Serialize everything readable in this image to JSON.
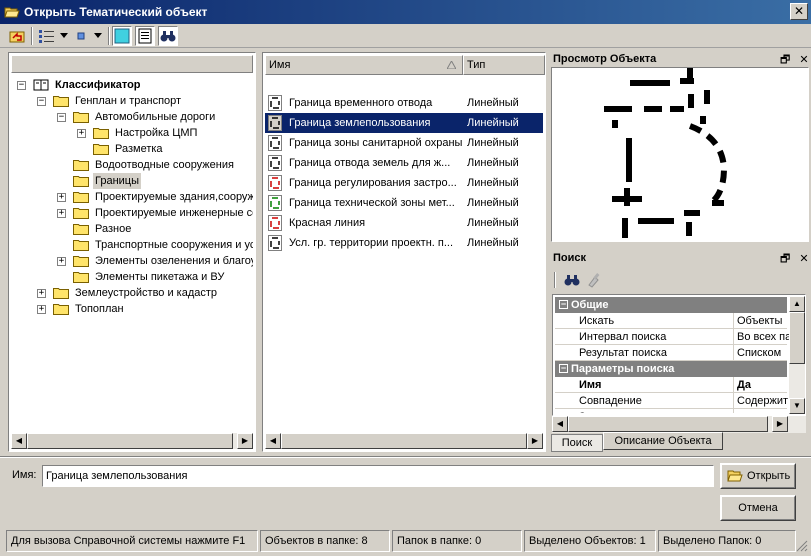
{
  "window": {
    "title": "Открыть Тематический объект",
    "close_glyph": "✕"
  },
  "toolbar": {
    "buttons": [
      {
        "name": "up-folder-icon"
      },
      {
        "name": "view-mode-icon"
      },
      {
        "name": "small-icons-icon"
      },
      {
        "name": "preview-toggle-icon"
      },
      {
        "name": "description-icon"
      },
      {
        "name": "find-icon"
      }
    ]
  },
  "tree": {
    "items": [
      {
        "label": "Классификатор",
        "level": 0,
        "toggle": "−",
        "bold": true,
        "book": true
      },
      {
        "label": "Генплан и транспорт",
        "level": 1,
        "toggle": "−"
      },
      {
        "label": "Автомобильные дороги",
        "level": 2,
        "toggle": "−"
      },
      {
        "label": "Настройка ЦМП",
        "level": 3,
        "toggle": "+"
      },
      {
        "label": "Разметка",
        "level": 3,
        "toggle": ""
      },
      {
        "label": "Водоотводные сооружения",
        "level": 2,
        "toggle": ""
      },
      {
        "label": "Границы",
        "level": 2,
        "toggle": "",
        "selected": true
      },
      {
        "label": "Проектируемые здания,сооруж",
        "level": 2,
        "toggle": "+"
      },
      {
        "label": "Проектируемые инженерные се",
        "level": 2,
        "toggle": "+"
      },
      {
        "label": "Разное",
        "level": 2,
        "toggle": ""
      },
      {
        "label": "Транспортные сооружения  и ус",
        "level": 2,
        "toggle": ""
      },
      {
        "label": "Элементы озеленения и благоу",
        "level": 2,
        "toggle": "+"
      },
      {
        "label": "Элементы пикетажа и ВУ",
        "level": 2,
        "toggle": ""
      },
      {
        "label": "Землеустройство и кадастр",
        "level": 1,
        "toggle": "+"
      },
      {
        "label": "Топоплан",
        "level": 1,
        "toggle": "+"
      }
    ]
  },
  "list": {
    "columns": {
      "name": "Имя",
      "type": "Тип"
    },
    "rows": [
      {
        "name": "Граница временного отвода",
        "type": "Линейный",
        "color": "#000000"
      },
      {
        "name": "Граница землепользования",
        "type": "Линейный",
        "color": "#000000",
        "selected": true
      },
      {
        "name": "Граница зоны санитарной охраны",
        "type": "Линейный",
        "color": "#000000"
      },
      {
        "name": "Граница отвода земель для ж...",
        "type": "Линейный",
        "color": "#000000"
      },
      {
        "name": "Граница регулирования застро...",
        "type": "Линейный",
        "color": "#cc0000"
      },
      {
        "name": "Граница технической  зоны мет...",
        "type": "Линейный",
        "color": "#008000"
      },
      {
        "name": "Красная линия",
        "type": "Линейный",
        "color": "#cc0000"
      },
      {
        "name": "Усл. гр. территории проектн. п...",
        "type": "Линейный",
        "color": "#000000"
      }
    ]
  },
  "preview": {
    "title": "Просмотр Объекта",
    "restore_glyph": "🗗",
    "close_glyph": "✕"
  },
  "search": {
    "title": "Поиск",
    "restore_glyph": "🗗",
    "close_glyph": "✕",
    "categories": [
      {
        "label": "Общие",
        "rows": [
          {
            "key": "Искать",
            "value": "Объекты"
          },
          {
            "key": "Интервал поиска",
            "value": "Во всех пап"
          },
          {
            "key": "Результат поиска",
            "value": "Списком"
          }
        ]
      },
      {
        "label": "Параметры поиска",
        "header": {
          "key": "Имя",
          "value": "Да"
        },
        "rows": [
          {
            "key": "Совпадение",
            "value": "Содержит"
          },
          {
            "key": "Значение",
            "value": ""
          }
        ]
      }
    ],
    "tabs": [
      "Поиск",
      "Описание Объекта"
    ]
  },
  "bottom": {
    "name_label": "Имя:",
    "name_value": "Граница землепользования",
    "open_label": "Открыть",
    "cancel_label": "Отмена"
  },
  "status": {
    "help": "Для вызова Справочной системы нажмите F1",
    "objects_in_folder": "Объектов в папке: 8",
    "folders_in_folder": "Папок в папке: 0",
    "selected_objects": "Выделено Объектов: 1",
    "selected_folders": "Выделено Папок: 0"
  }
}
